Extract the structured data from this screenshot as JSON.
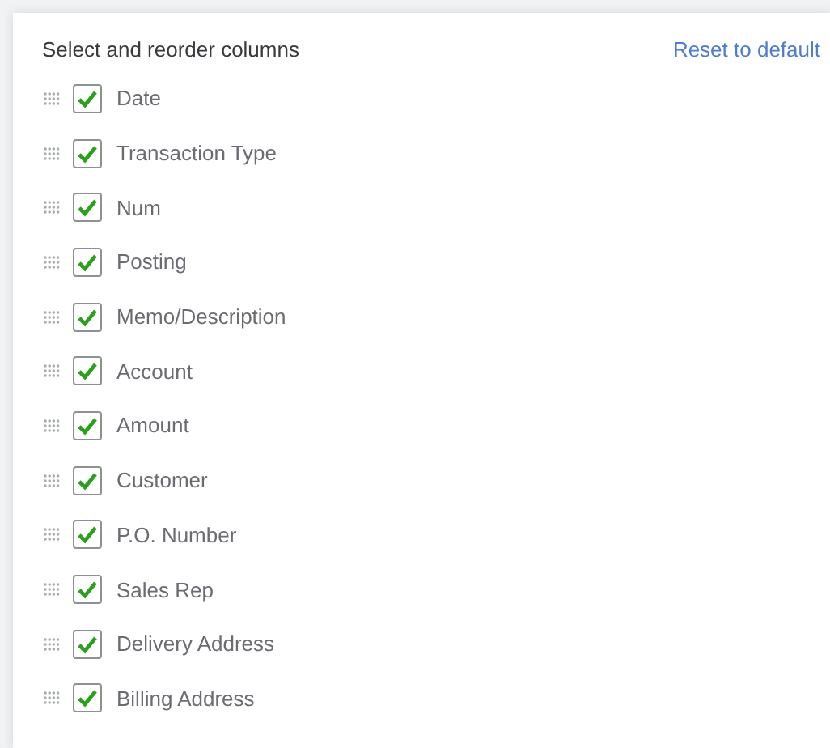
{
  "panel": {
    "title": "Select and reorder columns",
    "reset_link": "Reset to default"
  },
  "columns": [
    {
      "label": "Date",
      "checked": true
    },
    {
      "label": "Transaction Type",
      "checked": true
    },
    {
      "label": "Num",
      "checked": true
    },
    {
      "label": "Posting",
      "checked": true
    },
    {
      "label": "Memo/Description",
      "checked": true
    },
    {
      "label": "Account",
      "checked": true
    },
    {
      "label": "Amount",
      "checked": true
    },
    {
      "label": "Customer",
      "checked": true
    },
    {
      "label": "P.O. Number",
      "checked": true
    },
    {
      "label": "Sales Rep",
      "checked": true
    },
    {
      "label": "Delivery Address",
      "checked": true
    },
    {
      "label": "Billing Address",
      "checked": true
    }
  ]
}
